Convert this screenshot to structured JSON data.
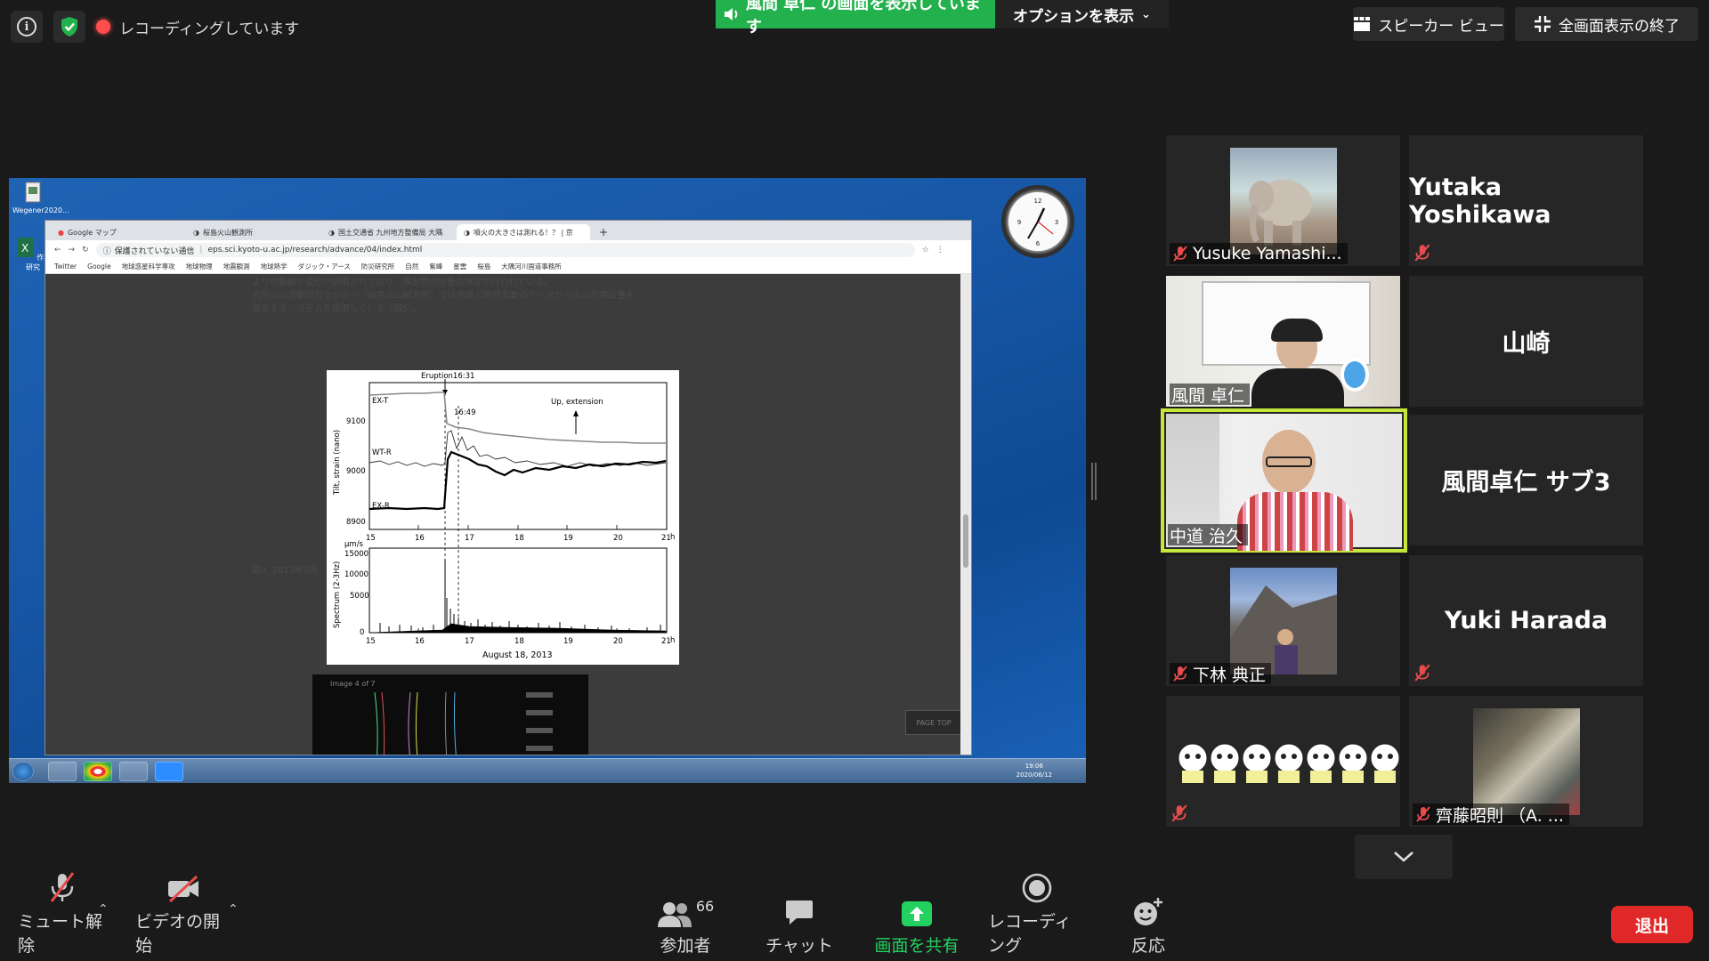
{
  "top_bar": {
    "recording_status": "レコーディングしています",
    "share_banner": "風間 卓仁 の画面を表示しています",
    "options_label": "オプションを表示",
    "speaker_view_label": "スピーカー ビュー",
    "exit_fullscreen_label": "全画面表示の終了"
  },
  "shared_screen": {
    "desktop_icons": [
      {
        "label": "Wegener2020..."
      },
      {
        "label": "作業研究"
      }
    ],
    "browser": {
      "tabs": [
        {
          "label": "Google マップ"
        },
        {
          "label": "桜島火山観測所"
        },
        {
          "label": "国土交通省 九州地方整備局 大隅"
        },
        {
          "label": "噴火の大きさは測れる！？ | 京"
        }
      ],
      "url_prefix": "保護されていない通信",
      "url": "eps.sci.kyoto-u.ac.jp/research/advance/04/index.html",
      "bookmarks": [
        "Twitter",
        "Google",
        "地球惑星科学専攻",
        "地球物理",
        "地震観測",
        "地球熱学",
        "ダジック・アース",
        "防災研究所",
        "自然",
        "紫峰",
        "星雲",
        "桜島",
        "大隅河川国道事務所"
      ],
      "page_text": {
        "paragraph_line1": "より地震動や変形が説明されており、噴出物の総量の推定が行われている。",
        "paragraph_line2": "究所火山活動研究センター（桜島火山観測所）では地震と地殻変動のデータから火山灰噴出量を",
        "paragraph_line3": "推定するシステムを運用している（図5）。",
        "caption": "図4. 2013年8月",
        "viewer_label": "Image 4 of 7",
        "page_top": "PAGE TOP"
      },
      "figure": {
        "eruption_label": "Eruption16:31",
        "time_label": "16:49",
        "up_extension_label": "Up, extension",
        "trace_labels": [
          "EX-T",
          "WT-R",
          "EX-R"
        ],
        "top_ylabel": "Tilt, strain (nano)",
        "top_yticks": [
          "9100",
          "9000",
          "8900"
        ],
        "bottom_ylabel": "Spectrum  (2-3Hz)",
        "bottom_unit": "μm/s",
        "bottom_yticks": [
          "15000",
          "10000",
          "5000",
          "0"
        ],
        "xticks": [
          "15",
          "16",
          "17",
          "18",
          "19",
          "20",
          "21"
        ],
        "x_unit": "h",
        "date_label": "August 18, 2013"
      }
    },
    "taskbar": {
      "time": "19:06",
      "date": "2020/06/12"
    }
  },
  "participants": [
    {
      "name": "Yusuke Yamashi...",
      "muted": true,
      "has_photo": true
    },
    {
      "name": "Yutaka Yoshikawa",
      "muted": true,
      "has_photo": false
    },
    {
      "name": "風間 卓仁",
      "muted": false,
      "has_photo": true
    },
    {
      "name": "山崎",
      "muted": false,
      "has_photo": false
    },
    {
      "name": "中道 治久",
      "muted": false,
      "has_photo": true,
      "active_speaker": true
    },
    {
      "name": "風間卓仁 サブ3",
      "muted": false,
      "has_photo": false
    },
    {
      "name": "下林 典正",
      "muted": true,
      "has_photo": true
    },
    {
      "name": "Yuki Harada",
      "muted": true,
      "has_photo": false
    },
    {
      "name": "",
      "muted": true,
      "has_photo": true
    },
    {
      "name": "齊藤昭則 （A. ...",
      "muted": true,
      "has_photo": true
    }
  ],
  "toolbar": {
    "unmute_label": "ミュート解除",
    "start_video_label": "ビデオの開始",
    "participants_label": "参加者",
    "participants_count": "66",
    "chat_label": "チャット",
    "share_screen_label": "画面を共有",
    "recording_label": "レコーディング",
    "reactions_label": "反応",
    "leave_label": "退出"
  },
  "colors": {
    "share_green": "#23b14d",
    "active_speaker_border": "#c5e63a",
    "leave_red": "#e02828",
    "muted_red": "#e84b4b"
  }
}
